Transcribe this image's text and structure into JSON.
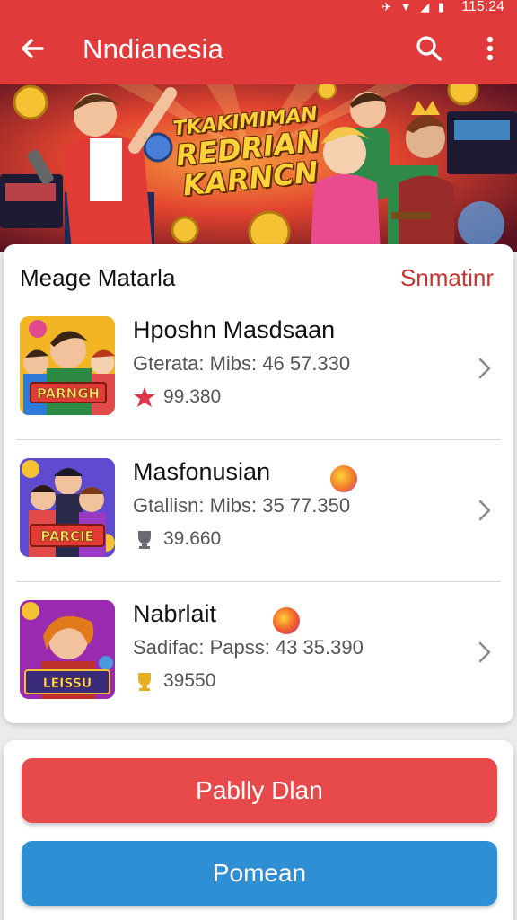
{
  "status_bar": {
    "time": "115:24"
  },
  "app_bar": {
    "title": "Nndianesia"
  },
  "banner": {
    "line1": "TKAKIMIMAN",
    "line2": "REDRIAN",
    "line3": "KARNCN"
  },
  "section": {
    "title": "Meage Matarla",
    "action": "Snmatinr"
  },
  "rows": [
    {
      "title": "Hposhn Masdsaan",
      "meta": "Gterata: Mibs: 46 57.330",
      "stat": "99.380",
      "thumb_label": "PARNGH"
    },
    {
      "title": "Masfonusian",
      "meta": "Gtallisn: Mibs: 35 77.350",
      "stat": "39.660",
      "thumb_label": "PARCIE"
    },
    {
      "title": "Nabrlait",
      "meta": "Sadifac: Papss: 43 35.390",
      "stat": "39550",
      "thumb_label": "LEISSU"
    }
  ],
  "buttons": {
    "primary": "Pablly Dlan",
    "secondary": "Pomean"
  },
  "colors": {
    "brand": "#e03a3a",
    "accent_text": "#c8312f",
    "secondary_button": "#2f8fd4"
  },
  "icons": [
    "back-arrow-icon",
    "search-icon",
    "more-vert-icon",
    "chevron-right-icon",
    "star-icon",
    "trophy-icon",
    "badge-icon"
  ]
}
